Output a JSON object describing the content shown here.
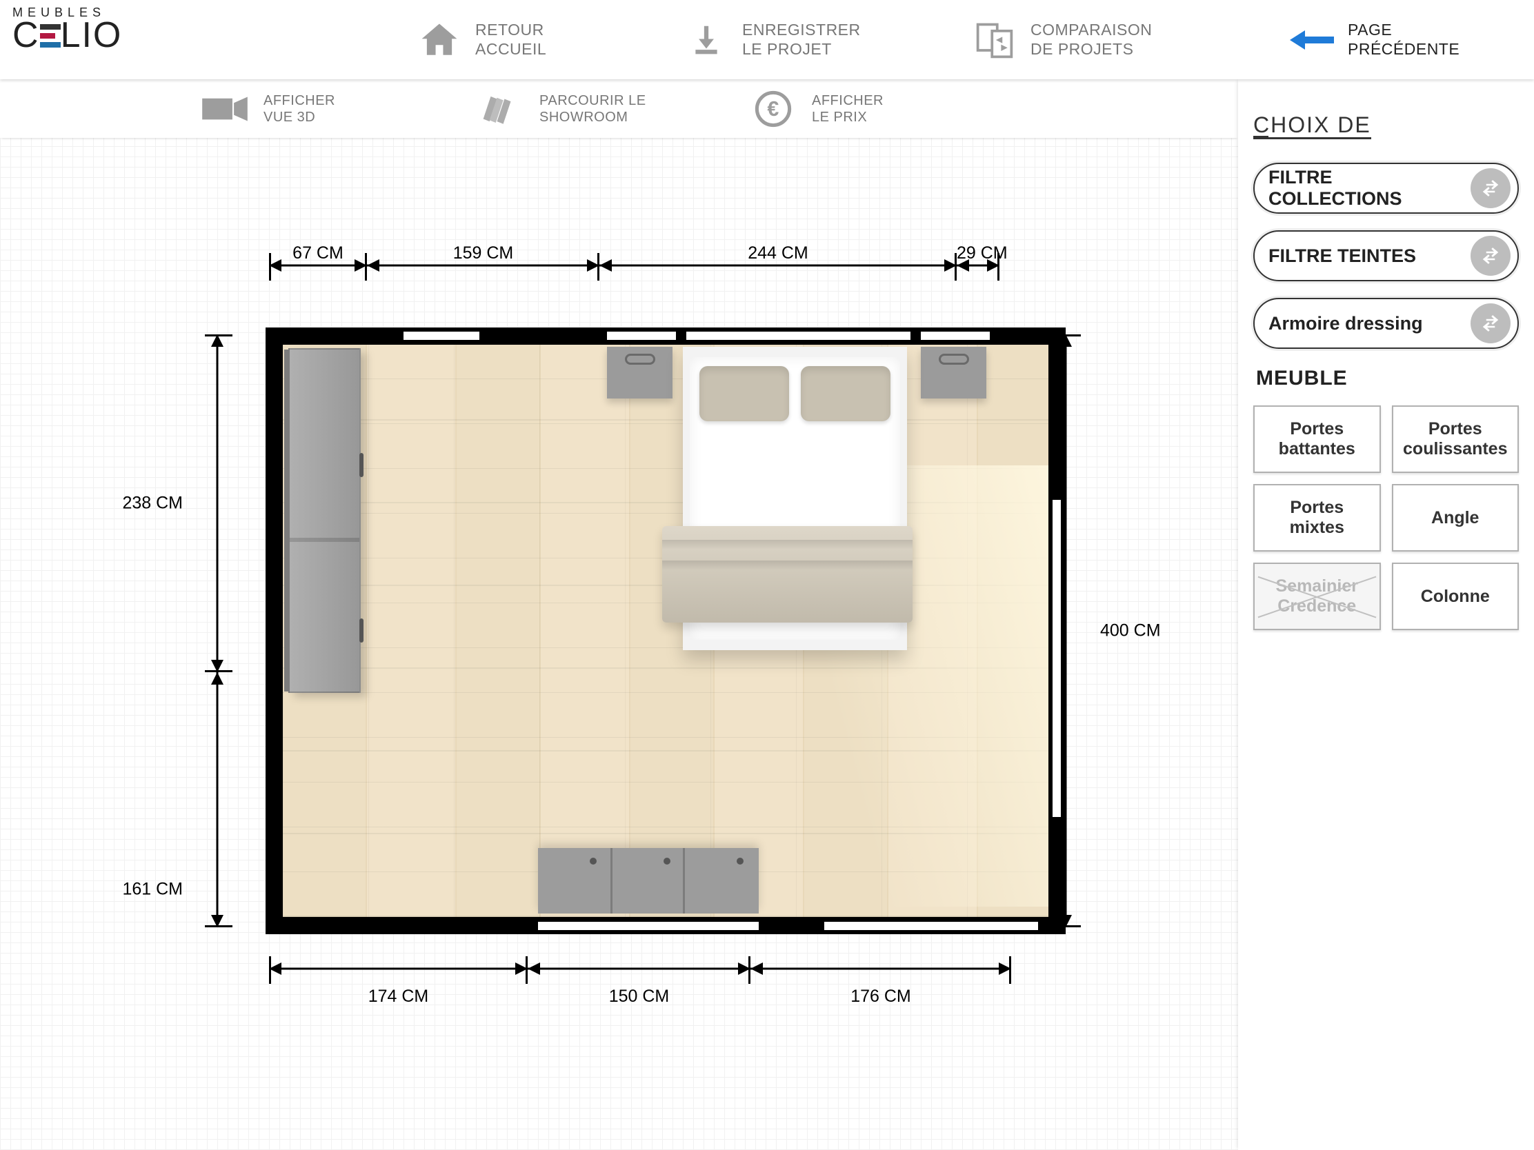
{
  "brand": {
    "line1": "MEUBLES",
    "line2_pre": "C",
    "line2_post": "LIO"
  },
  "topbar": {
    "home": {
      "l1": "RETOUR",
      "l2": "ACCUEIL"
    },
    "save": {
      "l1": "ENREGISTRER",
      "l2": "LE PROJET"
    },
    "compare": {
      "l1": "COMPARAISON",
      "l2": "DE PROJETS"
    },
    "prev": {
      "l1": "PAGE",
      "l2": "PRÉCÉDENTE"
    }
  },
  "subbar": {
    "view3d": {
      "l1": "AFFICHER",
      "l2": "VUE 3D"
    },
    "showroom": {
      "l1": "PARCOURIR LE",
      "l2": "SHOWROOM"
    },
    "price": {
      "l1": "AFFICHER",
      "l2": "LE PRIX"
    }
  },
  "dimensions": {
    "top": [
      "67 CM",
      "159 CM",
      "244 CM",
      "29 CM"
    ],
    "leftA": "238 CM",
    "leftB": "161 CM",
    "right": "400 CM",
    "bottom": [
      "174 CM",
      "150 CM",
      "176 CM"
    ]
  },
  "sidepanel": {
    "title": "CHOIX DE",
    "filters": {
      "collections": "FILTRE COLLECTIONS",
      "teintes": "FILTRE TEINTES",
      "armoire": "Armoire dressing"
    },
    "section": "MEUBLE",
    "tiles": {
      "battantes": "Portes battantes",
      "coulissantes": "Portes coulissantes",
      "mixtes": "Portes mixtes",
      "angle": "Angle",
      "semainier": "Semainier Credence",
      "colonne": "Colonne"
    }
  }
}
